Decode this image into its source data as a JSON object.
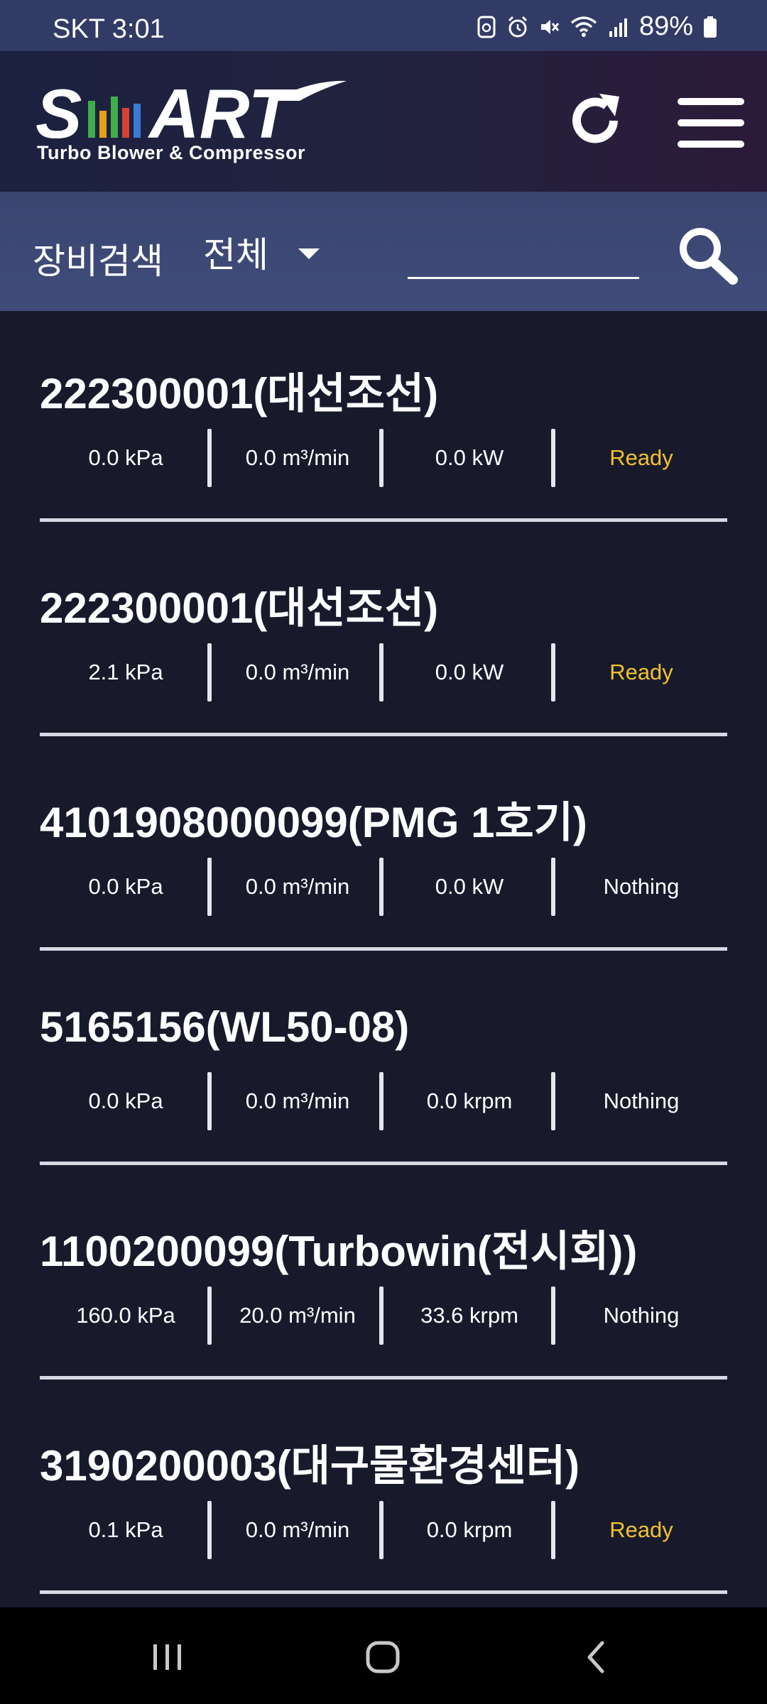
{
  "status_bar": {
    "carrier_time": "SKT 3:01",
    "battery": "89%",
    "icons": [
      "recycle-lock-icon",
      "alarm-icon",
      "mute-icon",
      "wifi-icon",
      "signal-icon",
      "battery-icon"
    ]
  },
  "header": {
    "logo_text": "SMART",
    "logo_subtitle": "Turbo Blower & Compressor",
    "refresh_icon": "refresh-icon",
    "menu_icon": "hamburger-menu-icon"
  },
  "search": {
    "label": "장비검색",
    "filter_selected": "전체",
    "input_value": "",
    "search_icon": "search-icon"
  },
  "devices": [
    {
      "name": "222300001(대선조선)",
      "pressure": "0.0 kPa",
      "flow": "0.0 m³/min",
      "third": "0.0 kW",
      "status": "Ready"
    },
    {
      "name": "222300001(대선조선)",
      "pressure": "2.1 kPa",
      "flow": "0.0 m³/min",
      "third": "0.0 kW",
      "status": "Ready"
    },
    {
      "name": "4101908000099(PMG 1호기)",
      "pressure": "0.0 kPa",
      "flow": "0.0 m³/min",
      "third": "0.0 kW",
      "status": "Nothing"
    },
    {
      "name": "5165156(WL50-08)",
      "pressure": "0.0 kPa",
      "flow": "0.0 m³/min",
      "third": "0.0 krpm",
      "status": "Nothing"
    },
    {
      "name": "1100200099(Turbowin(전시회))",
      "pressure": "160.0 kPa",
      "flow": "20.0 m³/min",
      "third": "33.6 krpm",
      "status": "Nothing"
    },
    {
      "name": "3190200003(대구물환경센터)",
      "pressure": "0.1 kPa",
      "flow": "0.0 m³/min",
      "third": "0.0 krpm",
      "status": "Ready"
    }
  ],
  "colors": {
    "status_ready": "#f2c230",
    "status_nothing": "#ffffff",
    "background": "#181a2c",
    "search_bar": "#3d4876"
  },
  "nav_bar": {
    "icons": [
      "recent-apps-icon",
      "home-icon",
      "back-icon"
    ]
  }
}
